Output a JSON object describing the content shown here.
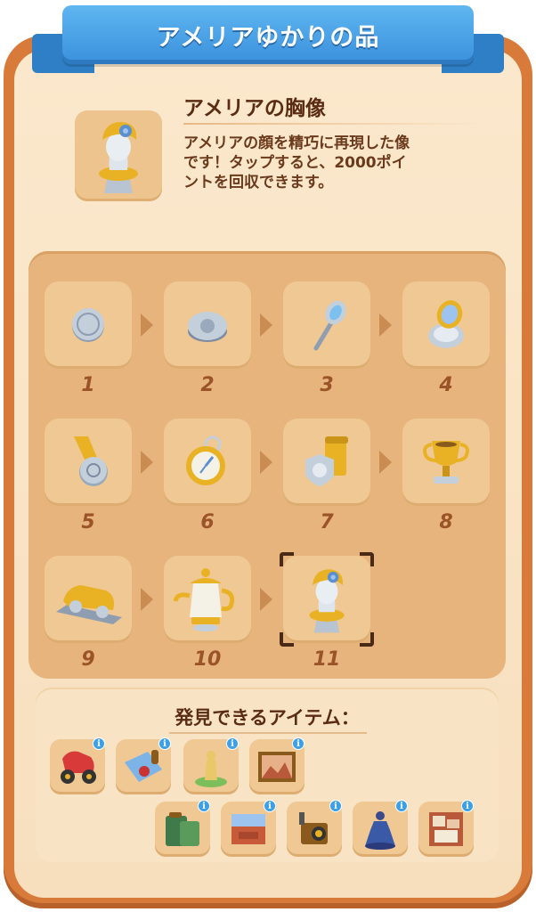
{
  "header": {
    "title": "アメリアゆかりの品"
  },
  "selected_item": {
    "name": "アメリアの胸像",
    "description_lines": [
      "アメリアの顔を精巧に再現した像",
      "です！タップすると、2000ポイ",
      "ントを回収できます。"
    ],
    "icon": "amelia-bust-icon"
  },
  "merge_chain": [
    {
      "level": "1",
      "icon": "silver-coin-icon"
    },
    {
      "level": "2",
      "icon": "silver-brooch-icon"
    },
    {
      "level": "3",
      "icon": "hand-mirror-icon"
    },
    {
      "level": "4",
      "icon": "compact-mirror-icon"
    },
    {
      "level": "5",
      "icon": "medal-icon"
    },
    {
      "level": "6",
      "icon": "pocket-watch-icon"
    },
    {
      "level": "7",
      "icon": "banner-medal-icon"
    },
    {
      "level": "8",
      "icon": "trophy-icon"
    },
    {
      "level": "9",
      "icon": "car-model-icon"
    },
    {
      "level": "10",
      "icon": "teapot-icon"
    },
    {
      "level": "11",
      "icon": "amelia-bust-icon",
      "selected": true
    }
  ],
  "found_in": {
    "title": "発見できるアイテム：",
    "info_glyph": "i",
    "items": [
      {
        "icon": "vintage-car-icon"
      },
      {
        "icon": "letter-wax-seal-icon"
      },
      {
        "icon": "statue-icon"
      },
      {
        "icon": "painting-icon"
      },
      {
        "icon": "green-suitcase-icon"
      },
      {
        "icon": "display-case-icon"
      },
      {
        "icon": "camera-icon"
      },
      {
        "icon": "dress-mannequin-icon"
      },
      {
        "icon": "collage-board-icon"
      }
    ]
  },
  "colors": {
    "ribbon": "#3a90dc",
    "frame": "#d87a3a",
    "panel": "#fbe8cc",
    "gold": "#e8b224",
    "silver": "#c4cfdc"
  }
}
